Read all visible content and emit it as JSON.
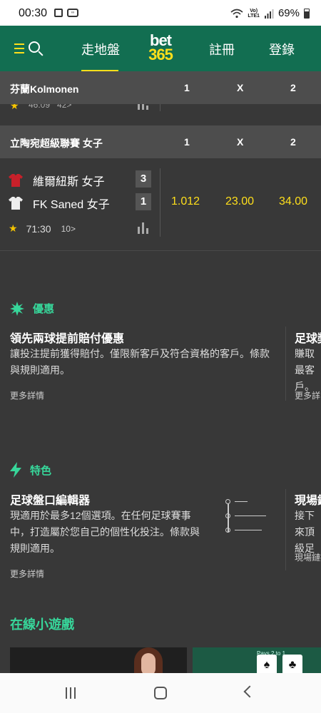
{
  "status": {
    "time": "00:30",
    "network": "LTE1",
    "battery": "69%"
  },
  "header": {
    "nav_live": "走地盤",
    "logo_top": "bet",
    "logo_bottom": "365",
    "nav_register": "註冊",
    "nav_login": "登錄"
  },
  "competitions": [
    {
      "name": "芬蘭Kolmonen",
      "col1": "1",
      "colx": "X",
      "col2": "2"
    },
    {
      "name": "立陶宛超級聯賽 女子",
      "col1": "1",
      "colx": "X",
      "col2": "2"
    }
  ],
  "partial_row": {
    "time": "46:09",
    "more": "42>"
  },
  "match": {
    "home": "維爾紐斯 女子",
    "away": "FK Saned 女子",
    "home_score": "3",
    "away_score": "1",
    "odds_1": "1.012",
    "odds_x": "23.00",
    "odds_2": "34.00",
    "time": "71:30",
    "more": "10>"
  },
  "offers": {
    "section_title": "優惠",
    "card1": {
      "title": "領先兩球提前賠付優惠",
      "text": "讓投注提前獲得賠付。僅限新客戶及符合資格的客戶。條款與規則適用。",
      "more": "更多詳情"
    },
    "card2": {
      "title": "足球獎",
      "text": "賺取最客戶。",
      "more": "更多詳"
    }
  },
  "features": {
    "section_title": "特色",
    "card1": {
      "title": "足球盤口編輯器",
      "text": "現適用於最多12個選項。在任何足球賽事中，打造屬於您自己的個性化投注。條款與規則適用。",
      "more": "更多詳情"
    },
    "card2": {
      "title": "現場鏈",
      "text": "接下來頂級足",
      "more": "現場鏈接"
    }
  },
  "games": {
    "title": "在線小遊戲",
    "table_text": "Pays 2 to 1"
  },
  "colors": {
    "header_green": "#126e51",
    "accent_yellow": "#ffdf1b",
    "section_green": "#37d69a",
    "bg": "#383838"
  }
}
